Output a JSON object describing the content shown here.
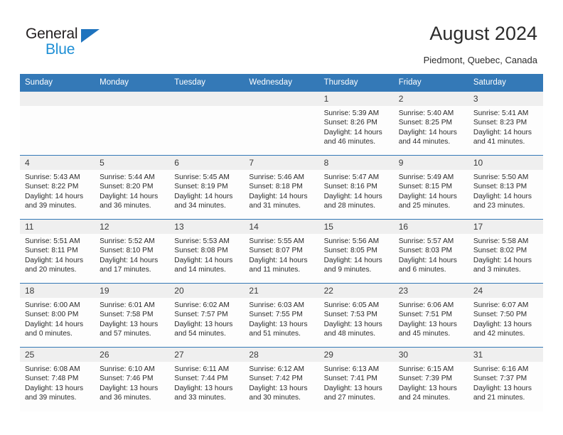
{
  "brand": {
    "name_part1": "General",
    "name_part2": "Blue",
    "triangle_color": "#1e73be",
    "blue_color": "#1e8fd5"
  },
  "header": {
    "title": "August 2024",
    "location": "Piedmont, Quebec, Canada"
  },
  "theme": {
    "header_bg": "#3479b7",
    "header_text": "#ffffff",
    "daynum_bg": "#efefef",
    "cell_bg": "#fdfdfd",
    "border": "#3479b7"
  },
  "weekdays": [
    "Sunday",
    "Monday",
    "Tuesday",
    "Wednesday",
    "Thursday",
    "Friday",
    "Saturday"
  ],
  "weeks": [
    [
      {
        "day": "",
        "blank": true
      },
      {
        "day": "",
        "blank": true
      },
      {
        "day": "",
        "blank": true
      },
      {
        "day": "",
        "blank": true
      },
      {
        "day": "1",
        "sunrise": "Sunrise: 5:39 AM",
        "sunset": "Sunset: 8:26 PM",
        "daylight_1": "Daylight: 14 hours",
        "daylight_2": "and 46 minutes."
      },
      {
        "day": "2",
        "sunrise": "Sunrise: 5:40 AM",
        "sunset": "Sunset: 8:25 PM",
        "daylight_1": "Daylight: 14 hours",
        "daylight_2": "and 44 minutes."
      },
      {
        "day": "3",
        "sunrise": "Sunrise: 5:41 AM",
        "sunset": "Sunset: 8:23 PM",
        "daylight_1": "Daylight: 14 hours",
        "daylight_2": "and 41 minutes."
      }
    ],
    [
      {
        "day": "4",
        "sunrise": "Sunrise: 5:43 AM",
        "sunset": "Sunset: 8:22 PM",
        "daylight_1": "Daylight: 14 hours",
        "daylight_2": "and 39 minutes."
      },
      {
        "day": "5",
        "sunrise": "Sunrise: 5:44 AM",
        "sunset": "Sunset: 8:20 PM",
        "daylight_1": "Daylight: 14 hours",
        "daylight_2": "and 36 minutes."
      },
      {
        "day": "6",
        "sunrise": "Sunrise: 5:45 AM",
        "sunset": "Sunset: 8:19 PM",
        "daylight_1": "Daylight: 14 hours",
        "daylight_2": "and 34 minutes."
      },
      {
        "day": "7",
        "sunrise": "Sunrise: 5:46 AM",
        "sunset": "Sunset: 8:18 PM",
        "daylight_1": "Daylight: 14 hours",
        "daylight_2": "and 31 minutes."
      },
      {
        "day": "8",
        "sunrise": "Sunrise: 5:47 AM",
        "sunset": "Sunset: 8:16 PM",
        "daylight_1": "Daylight: 14 hours",
        "daylight_2": "and 28 minutes."
      },
      {
        "day": "9",
        "sunrise": "Sunrise: 5:49 AM",
        "sunset": "Sunset: 8:15 PM",
        "daylight_1": "Daylight: 14 hours",
        "daylight_2": "and 25 minutes."
      },
      {
        "day": "10",
        "sunrise": "Sunrise: 5:50 AM",
        "sunset": "Sunset: 8:13 PM",
        "daylight_1": "Daylight: 14 hours",
        "daylight_2": "and 23 minutes."
      }
    ],
    [
      {
        "day": "11",
        "sunrise": "Sunrise: 5:51 AM",
        "sunset": "Sunset: 8:11 PM",
        "daylight_1": "Daylight: 14 hours",
        "daylight_2": "and 20 minutes."
      },
      {
        "day": "12",
        "sunrise": "Sunrise: 5:52 AM",
        "sunset": "Sunset: 8:10 PM",
        "daylight_1": "Daylight: 14 hours",
        "daylight_2": "and 17 minutes."
      },
      {
        "day": "13",
        "sunrise": "Sunrise: 5:53 AM",
        "sunset": "Sunset: 8:08 PM",
        "daylight_1": "Daylight: 14 hours",
        "daylight_2": "and 14 minutes."
      },
      {
        "day": "14",
        "sunrise": "Sunrise: 5:55 AM",
        "sunset": "Sunset: 8:07 PM",
        "daylight_1": "Daylight: 14 hours",
        "daylight_2": "and 11 minutes."
      },
      {
        "day": "15",
        "sunrise": "Sunrise: 5:56 AM",
        "sunset": "Sunset: 8:05 PM",
        "daylight_1": "Daylight: 14 hours",
        "daylight_2": "and 9 minutes."
      },
      {
        "day": "16",
        "sunrise": "Sunrise: 5:57 AM",
        "sunset": "Sunset: 8:03 PM",
        "daylight_1": "Daylight: 14 hours",
        "daylight_2": "and 6 minutes."
      },
      {
        "day": "17",
        "sunrise": "Sunrise: 5:58 AM",
        "sunset": "Sunset: 8:02 PM",
        "daylight_1": "Daylight: 14 hours",
        "daylight_2": "and 3 minutes."
      }
    ],
    [
      {
        "day": "18",
        "sunrise": "Sunrise: 6:00 AM",
        "sunset": "Sunset: 8:00 PM",
        "daylight_1": "Daylight: 14 hours",
        "daylight_2": "and 0 minutes."
      },
      {
        "day": "19",
        "sunrise": "Sunrise: 6:01 AM",
        "sunset": "Sunset: 7:58 PM",
        "daylight_1": "Daylight: 13 hours",
        "daylight_2": "and 57 minutes."
      },
      {
        "day": "20",
        "sunrise": "Sunrise: 6:02 AM",
        "sunset": "Sunset: 7:57 PM",
        "daylight_1": "Daylight: 13 hours",
        "daylight_2": "and 54 minutes."
      },
      {
        "day": "21",
        "sunrise": "Sunrise: 6:03 AM",
        "sunset": "Sunset: 7:55 PM",
        "daylight_1": "Daylight: 13 hours",
        "daylight_2": "and 51 minutes."
      },
      {
        "day": "22",
        "sunrise": "Sunrise: 6:05 AM",
        "sunset": "Sunset: 7:53 PM",
        "daylight_1": "Daylight: 13 hours",
        "daylight_2": "and 48 minutes."
      },
      {
        "day": "23",
        "sunrise": "Sunrise: 6:06 AM",
        "sunset": "Sunset: 7:51 PM",
        "daylight_1": "Daylight: 13 hours",
        "daylight_2": "and 45 minutes."
      },
      {
        "day": "24",
        "sunrise": "Sunrise: 6:07 AM",
        "sunset": "Sunset: 7:50 PM",
        "daylight_1": "Daylight: 13 hours",
        "daylight_2": "and 42 minutes."
      }
    ],
    [
      {
        "day": "25",
        "sunrise": "Sunrise: 6:08 AM",
        "sunset": "Sunset: 7:48 PM",
        "daylight_1": "Daylight: 13 hours",
        "daylight_2": "and 39 minutes."
      },
      {
        "day": "26",
        "sunrise": "Sunrise: 6:10 AM",
        "sunset": "Sunset: 7:46 PM",
        "daylight_1": "Daylight: 13 hours",
        "daylight_2": "and 36 minutes."
      },
      {
        "day": "27",
        "sunrise": "Sunrise: 6:11 AM",
        "sunset": "Sunset: 7:44 PM",
        "daylight_1": "Daylight: 13 hours",
        "daylight_2": "and 33 minutes."
      },
      {
        "day": "28",
        "sunrise": "Sunrise: 6:12 AM",
        "sunset": "Sunset: 7:42 PM",
        "daylight_1": "Daylight: 13 hours",
        "daylight_2": "and 30 minutes."
      },
      {
        "day": "29",
        "sunrise": "Sunrise: 6:13 AM",
        "sunset": "Sunset: 7:41 PM",
        "daylight_1": "Daylight: 13 hours",
        "daylight_2": "and 27 minutes."
      },
      {
        "day": "30",
        "sunrise": "Sunrise: 6:15 AM",
        "sunset": "Sunset: 7:39 PM",
        "daylight_1": "Daylight: 13 hours",
        "daylight_2": "and 24 minutes."
      },
      {
        "day": "31",
        "sunrise": "Sunrise: 6:16 AM",
        "sunset": "Sunset: 7:37 PM",
        "daylight_1": "Daylight: 13 hours",
        "daylight_2": "and 21 minutes."
      }
    ]
  ]
}
